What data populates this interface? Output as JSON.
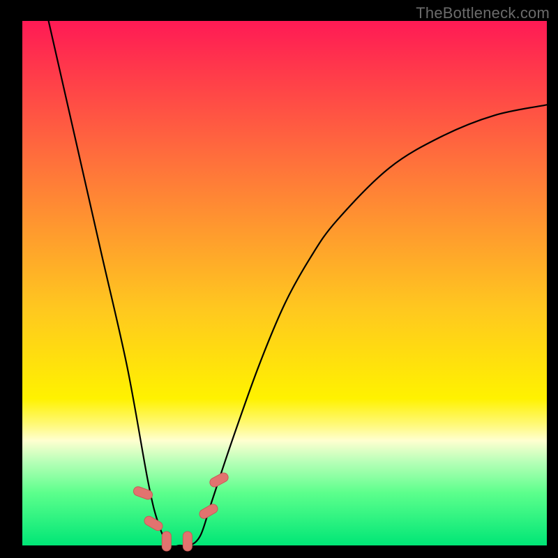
{
  "attribution": "TheBottleneck.com",
  "chart_data": {
    "type": "line",
    "title": "",
    "xlabel": "",
    "ylabel": "",
    "xlim": [
      0,
      100
    ],
    "ylim": [
      0,
      100
    ],
    "grid": false,
    "legend": false,
    "series": [
      {
        "name": "bottleneck-curve",
        "x": [
          5,
          10,
          15,
          20,
          24,
          26,
          28,
          30,
          32,
          34,
          36,
          40,
          45,
          50,
          55,
          60,
          70,
          80,
          90,
          100
        ],
        "y": [
          100,
          78,
          56,
          34,
          12,
          4,
          0,
          0,
          0,
          2,
          8,
          20,
          34,
          46,
          55,
          62,
          72,
          78,
          82,
          84
        ]
      }
    ],
    "markers": [
      {
        "x": 23.0,
        "y": 10.0,
        "angle": -70
      },
      {
        "x": 25.0,
        "y": 4.2,
        "angle": -60
      },
      {
        "x": 27.5,
        "y": 0.8,
        "angle": 0
      },
      {
        "x": 31.5,
        "y": 0.8,
        "angle": 0
      },
      {
        "x": 35.5,
        "y": 6.5,
        "angle": 60
      },
      {
        "x": 37.5,
        "y": 12.5,
        "angle": 62
      }
    ],
    "background_gradient": {
      "top": "#ff1a55",
      "mid": "#fff200",
      "bottom": "#00e676"
    }
  }
}
